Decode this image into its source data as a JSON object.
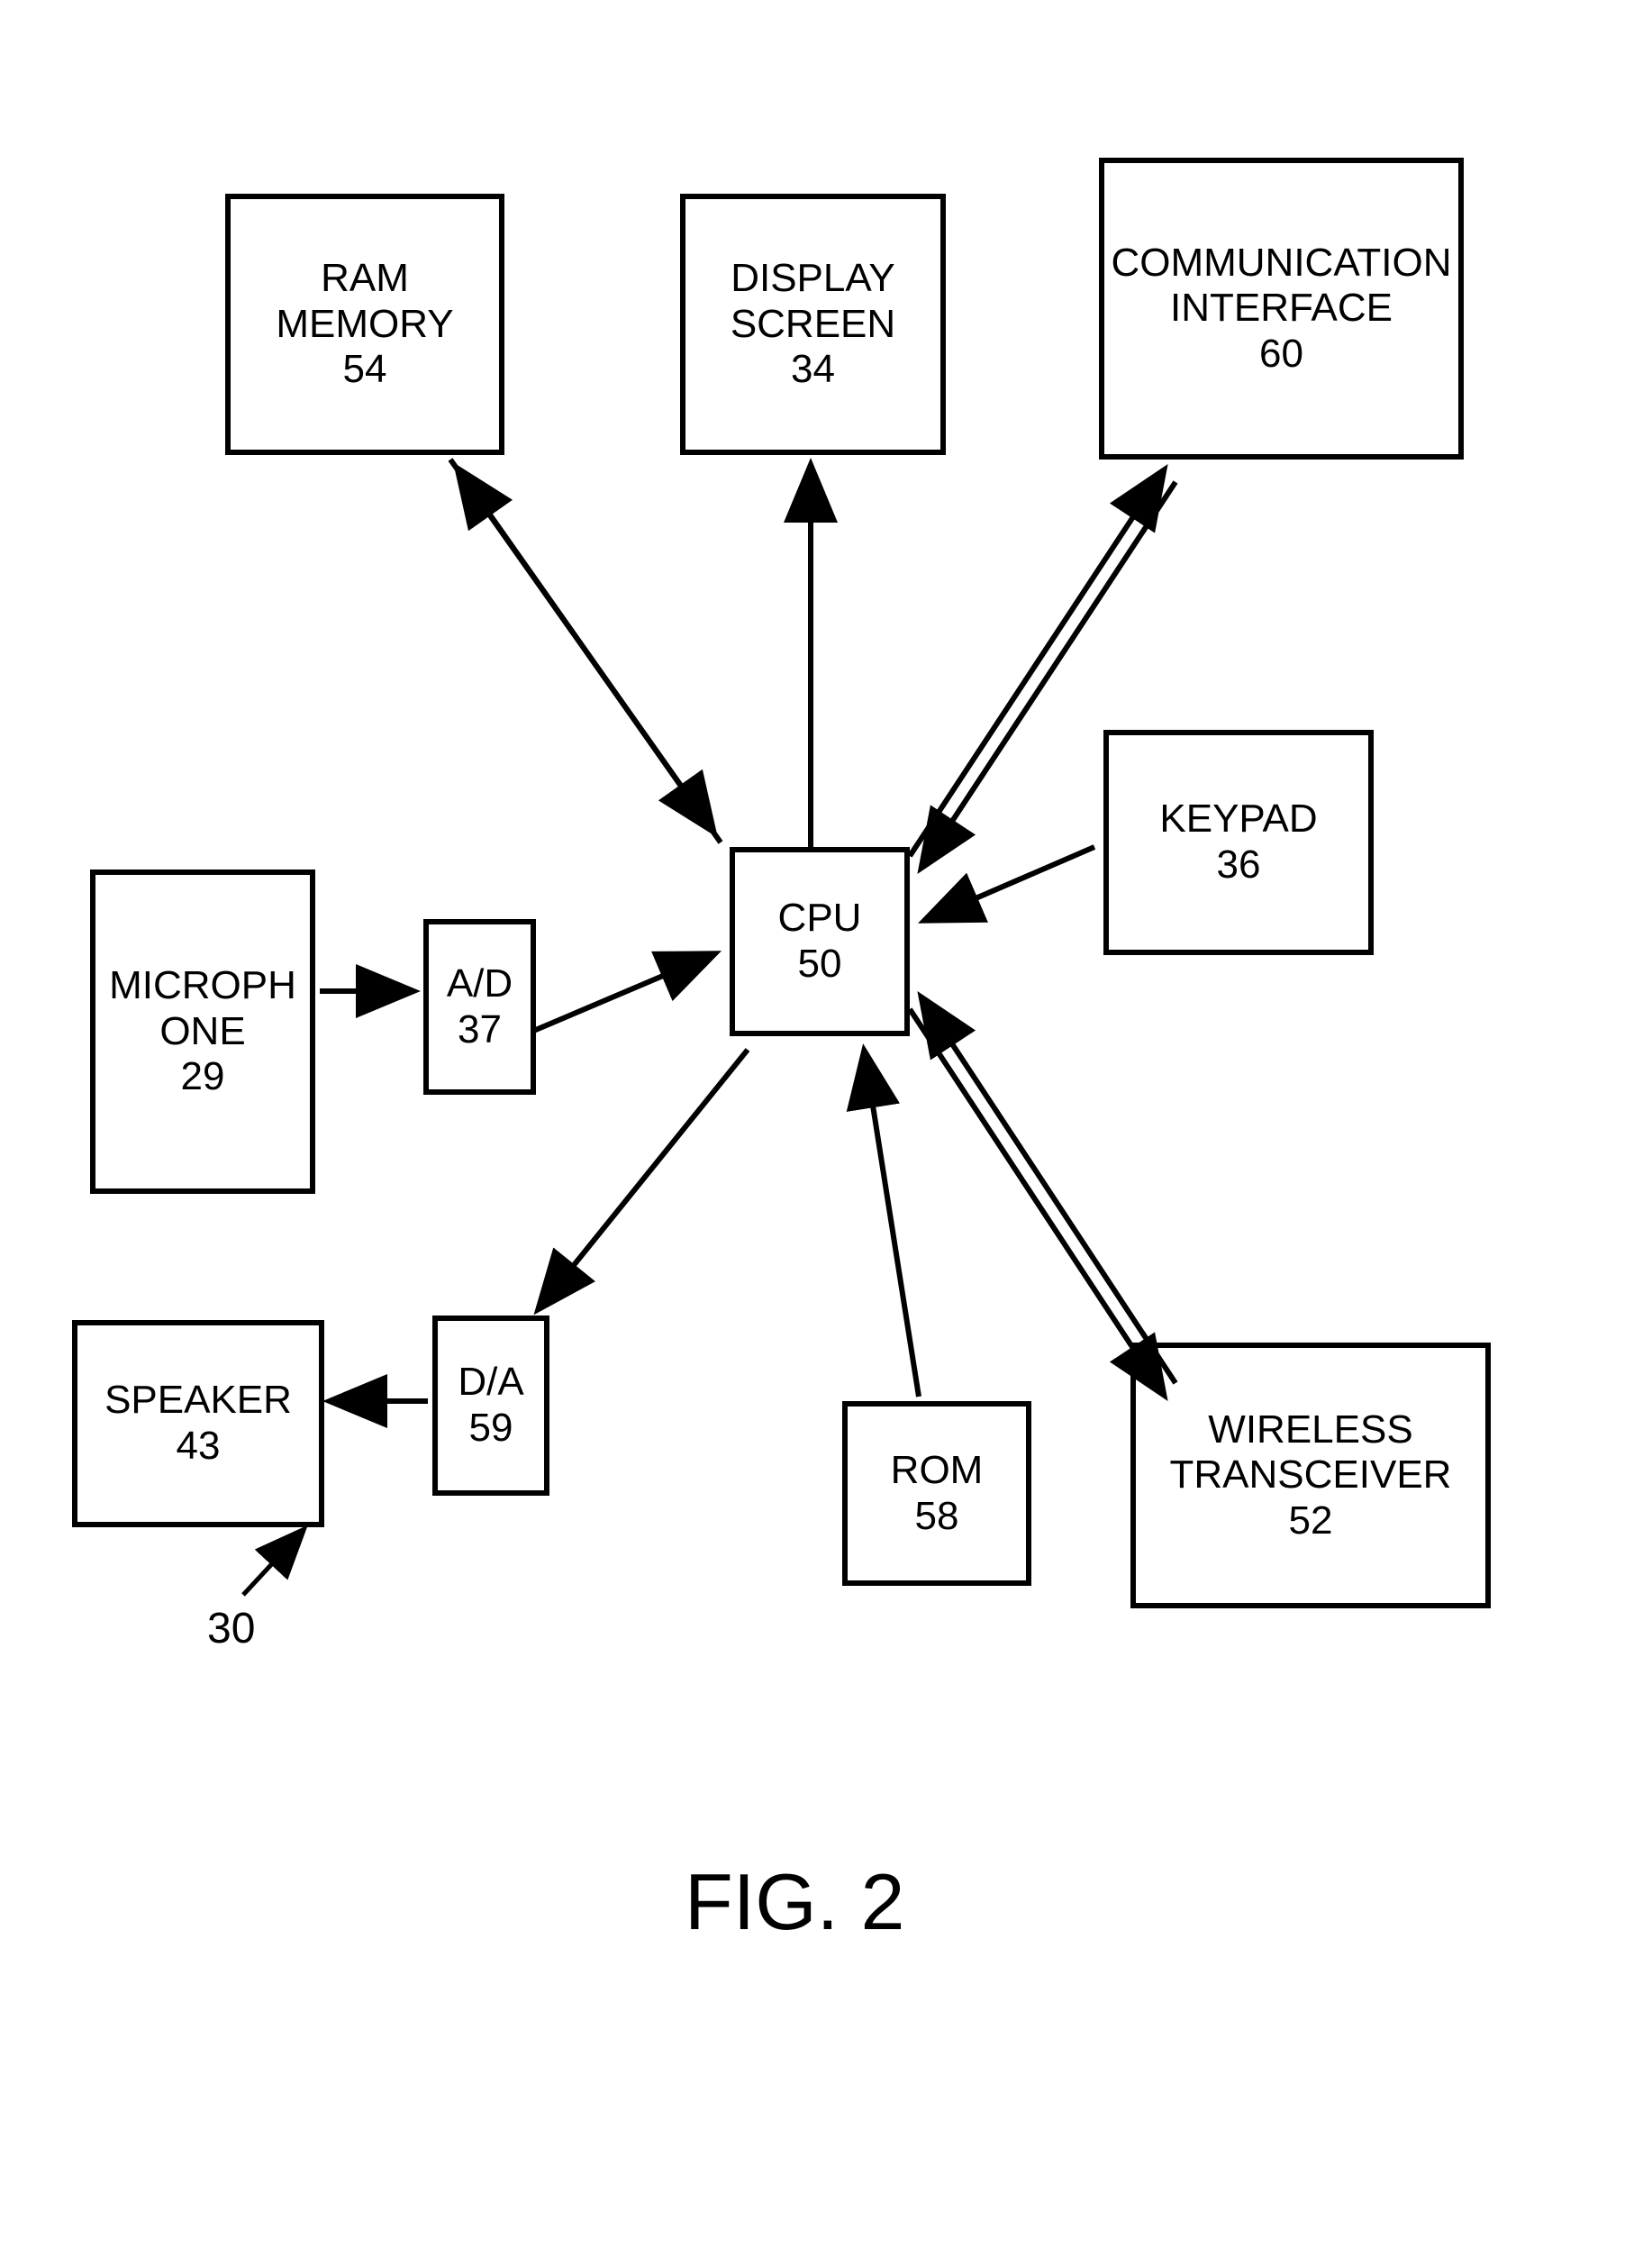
{
  "figure_label": "FIG. 2",
  "ref_pointer": "30",
  "blocks": {
    "cpu": {
      "label": "CPU",
      "num": "50"
    },
    "ram": {
      "label": "RAM MEMORY",
      "num": "54"
    },
    "display": {
      "label": "DISPLAY SCREEN",
      "num": "34"
    },
    "comm": {
      "label": "COMMUNICATION INTERFACE",
      "num": "60"
    },
    "keypad": {
      "label": "KEYPAD",
      "num": "36"
    },
    "wireless": {
      "label": "WIRELESS TRANSCEIVER",
      "num": "52"
    },
    "rom": {
      "label": "ROM",
      "num": "58"
    },
    "ad": {
      "label": "A/D",
      "num": "37"
    },
    "da": {
      "label": "D/A",
      "num": "59"
    },
    "mic": {
      "label": "MICROPHONE",
      "num": "29"
    },
    "speaker": {
      "label": "SPEAKER",
      "num": "43"
    }
  }
}
